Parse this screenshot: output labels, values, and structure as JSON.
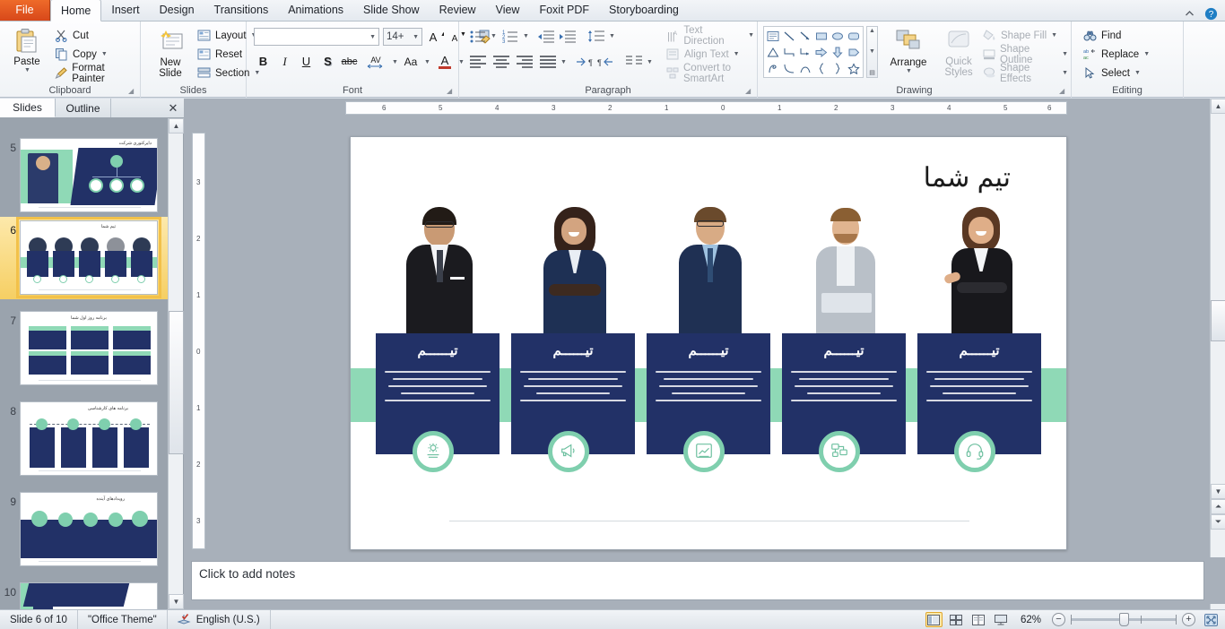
{
  "app": {
    "ribbon_tabs": [
      {
        "label": "File",
        "active": false
      },
      {
        "label": "Home",
        "active": true
      },
      {
        "label": "Insert",
        "active": false
      },
      {
        "label": "Design",
        "active": false
      },
      {
        "label": "Transitions",
        "active": false
      },
      {
        "label": "Animations",
        "active": false
      },
      {
        "label": "Slide Show",
        "active": false
      },
      {
        "label": "Review",
        "active": false
      },
      {
        "label": "View",
        "active": false
      },
      {
        "label": "Foxit PDF",
        "active": false
      },
      {
        "label": "Storyboarding",
        "active": false
      }
    ],
    "window_controls": {
      "collapse_ribbon": "collapse-ribbon-icon",
      "help": "help-icon"
    }
  },
  "ribbon": {
    "clipboard": {
      "title": "Clipboard",
      "paste": "Paste",
      "cut": "Cut",
      "copy": "Copy",
      "format_painter": "Format Painter"
    },
    "slides": {
      "title": "Slides",
      "new_slide": "New\nSlide",
      "new_slide_line1": "New",
      "new_slide_line2": "Slide",
      "layout": "Layout",
      "reset": "Reset",
      "section": "Section"
    },
    "font": {
      "title": "Font",
      "font_name_value": "",
      "font_name_placeholder": "",
      "font_size_value": "14+",
      "grow": "A",
      "shrink": "A",
      "clear_formatting": "clear-formatting-icon",
      "bold": "B",
      "italic": "I",
      "underline": "U",
      "shadow": "S",
      "strikethrough": "abc",
      "char_spacing": "AV",
      "change_case": "Aa",
      "font_color": "A"
    },
    "paragraph": {
      "title": "Paragraph",
      "bullets": "bullets-icon",
      "numbering": "numbering-icon",
      "decrease_indent": "decrease-indent-icon",
      "increase_indent": "increase-indent-icon",
      "line_spacing": "line-spacing-icon",
      "align_left": "align-left-icon",
      "align_center": "align-center-icon",
      "align_right": "align-right-icon",
      "justify": "justify-icon",
      "ltr": "left-to-right-icon",
      "rtl": "right-to-left-icon",
      "columns": "columns-icon",
      "text_direction": "Text Direction",
      "align_text": "Align Text",
      "convert_to_smartart": "Convert to SmartArt"
    },
    "drawing": {
      "title": "Drawing",
      "arrange": "Arrange",
      "quick_styles_line1": "Quick",
      "quick_styles_line2": "Styles",
      "shape_fill": "Shape Fill",
      "shape_outline": "Shape Outline",
      "shape_effects": "Shape Effects",
      "shapes": [
        "textbox",
        "line",
        "arrow",
        "rectangle",
        "oval",
        "rounded-rectangle",
        "triangle",
        "elbow-connector",
        "elbow-arrow-connector",
        "right-arrow",
        "down-arrow",
        "pentagon-banner",
        "freeform",
        "curve",
        "arc",
        "left-brace",
        "right-brace",
        "star"
      ]
    },
    "editing": {
      "title": "Editing",
      "find": "Find",
      "replace": "Replace",
      "select": "Select"
    }
  },
  "slides_panel": {
    "tabs": [
      {
        "label": "Slides",
        "active": true
      },
      {
        "label": "Outline",
        "active": false
      }
    ],
    "close": "close-icon",
    "thumbnails": [
      {
        "number": "5",
        "title": "دایرکتوری شرکت",
        "type": "org-chart",
        "selected": false
      },
      {
        "number": "6",
        "title": "تیم شما",
        "type": "team-cards",
        "selected": true
      },
      {
        "number": "7",
        "title": "برنامه روز اول شما",
        "type": "grid-6",
        "selected": false
      },
      {
        "number": "8",
        "title": "برنامه های کارشناسی",
        "type": "timeline-4",
        "selected": false
      },
      {
        "number": "9",
        "title": "رویدادهای آینده",
        "type": "timeline-5",
        "selected": false
      },
      {
        "number": "10",
        "title": "",
        "type": "cover",
        "selected": false
      }
    ]
  },
  "rulers": {
    "horizontal_ticks": [
      "6",
      "5",
      "4",
      "3",
      "2",
      "1",
      "0",
      "1",
      "2",
      "3",
      "4",
      "5",
      "6"
    ],
    "vertical_ticks": [
      "3",
      "2",
      "1",
      "0",
      "1",
      "2",
      "3"
    ]
  },
  "slide": {
    "title": "تیم شما",
    "accent_navy": "#223167",
    "accent_green": "#8fd9b6",
    "background": "#ffffff",
    "cards": [
      {
        "heading": "تیــــــم",
        "icon": "gear-settings-icon",
        "person": "man-black-suit-glasses"
      },
      {
        "heading": "تیــــــم",
        "icon": "megaphone-icon",
        "person": "woman-navy-blazer"
      },
      {
        "heading": "تیــــــم",
        "icon": "bar-chart-icon",
        "person": "man-navy-suit-glasses"
      },
      {
        "heading": "تیــــــم",
        "icon": "devices-network-icon",
        "person": "man-grey-blazer-laptop"
      },
      {
        "heading": "تیــــــم",
        "icon": "headset-support-icon",
        "person": "woman-black-suit"
      }
    ],
    "card_body_lines": 5
  },
  "notes": {
    "placeholder": "Click to add notes"
  },
  "status_bar": {
    "slide_counter": "Slide 6 of 10",
    "theme": "\"Office Theme\"",
    "spellcheck_icon": "spellcheck-icon",
    "language": "English (U.S.)",
    "views": [
      {
        "name": "normal-view",
        "active": true
      },
      {
        "name": "slide-sorter-view",
        "active": false
      },
      {
        "name": "reading-view",
        "active": false
      },
      {
        "name": "slide-show-view",
        "active": false
      }
    ],
    "zoom_level": "62%",
    "zoom_out": "−",
    "zoom_in": "+",
    "fit_to_window": "fit-to-window-icon"
  }
}
